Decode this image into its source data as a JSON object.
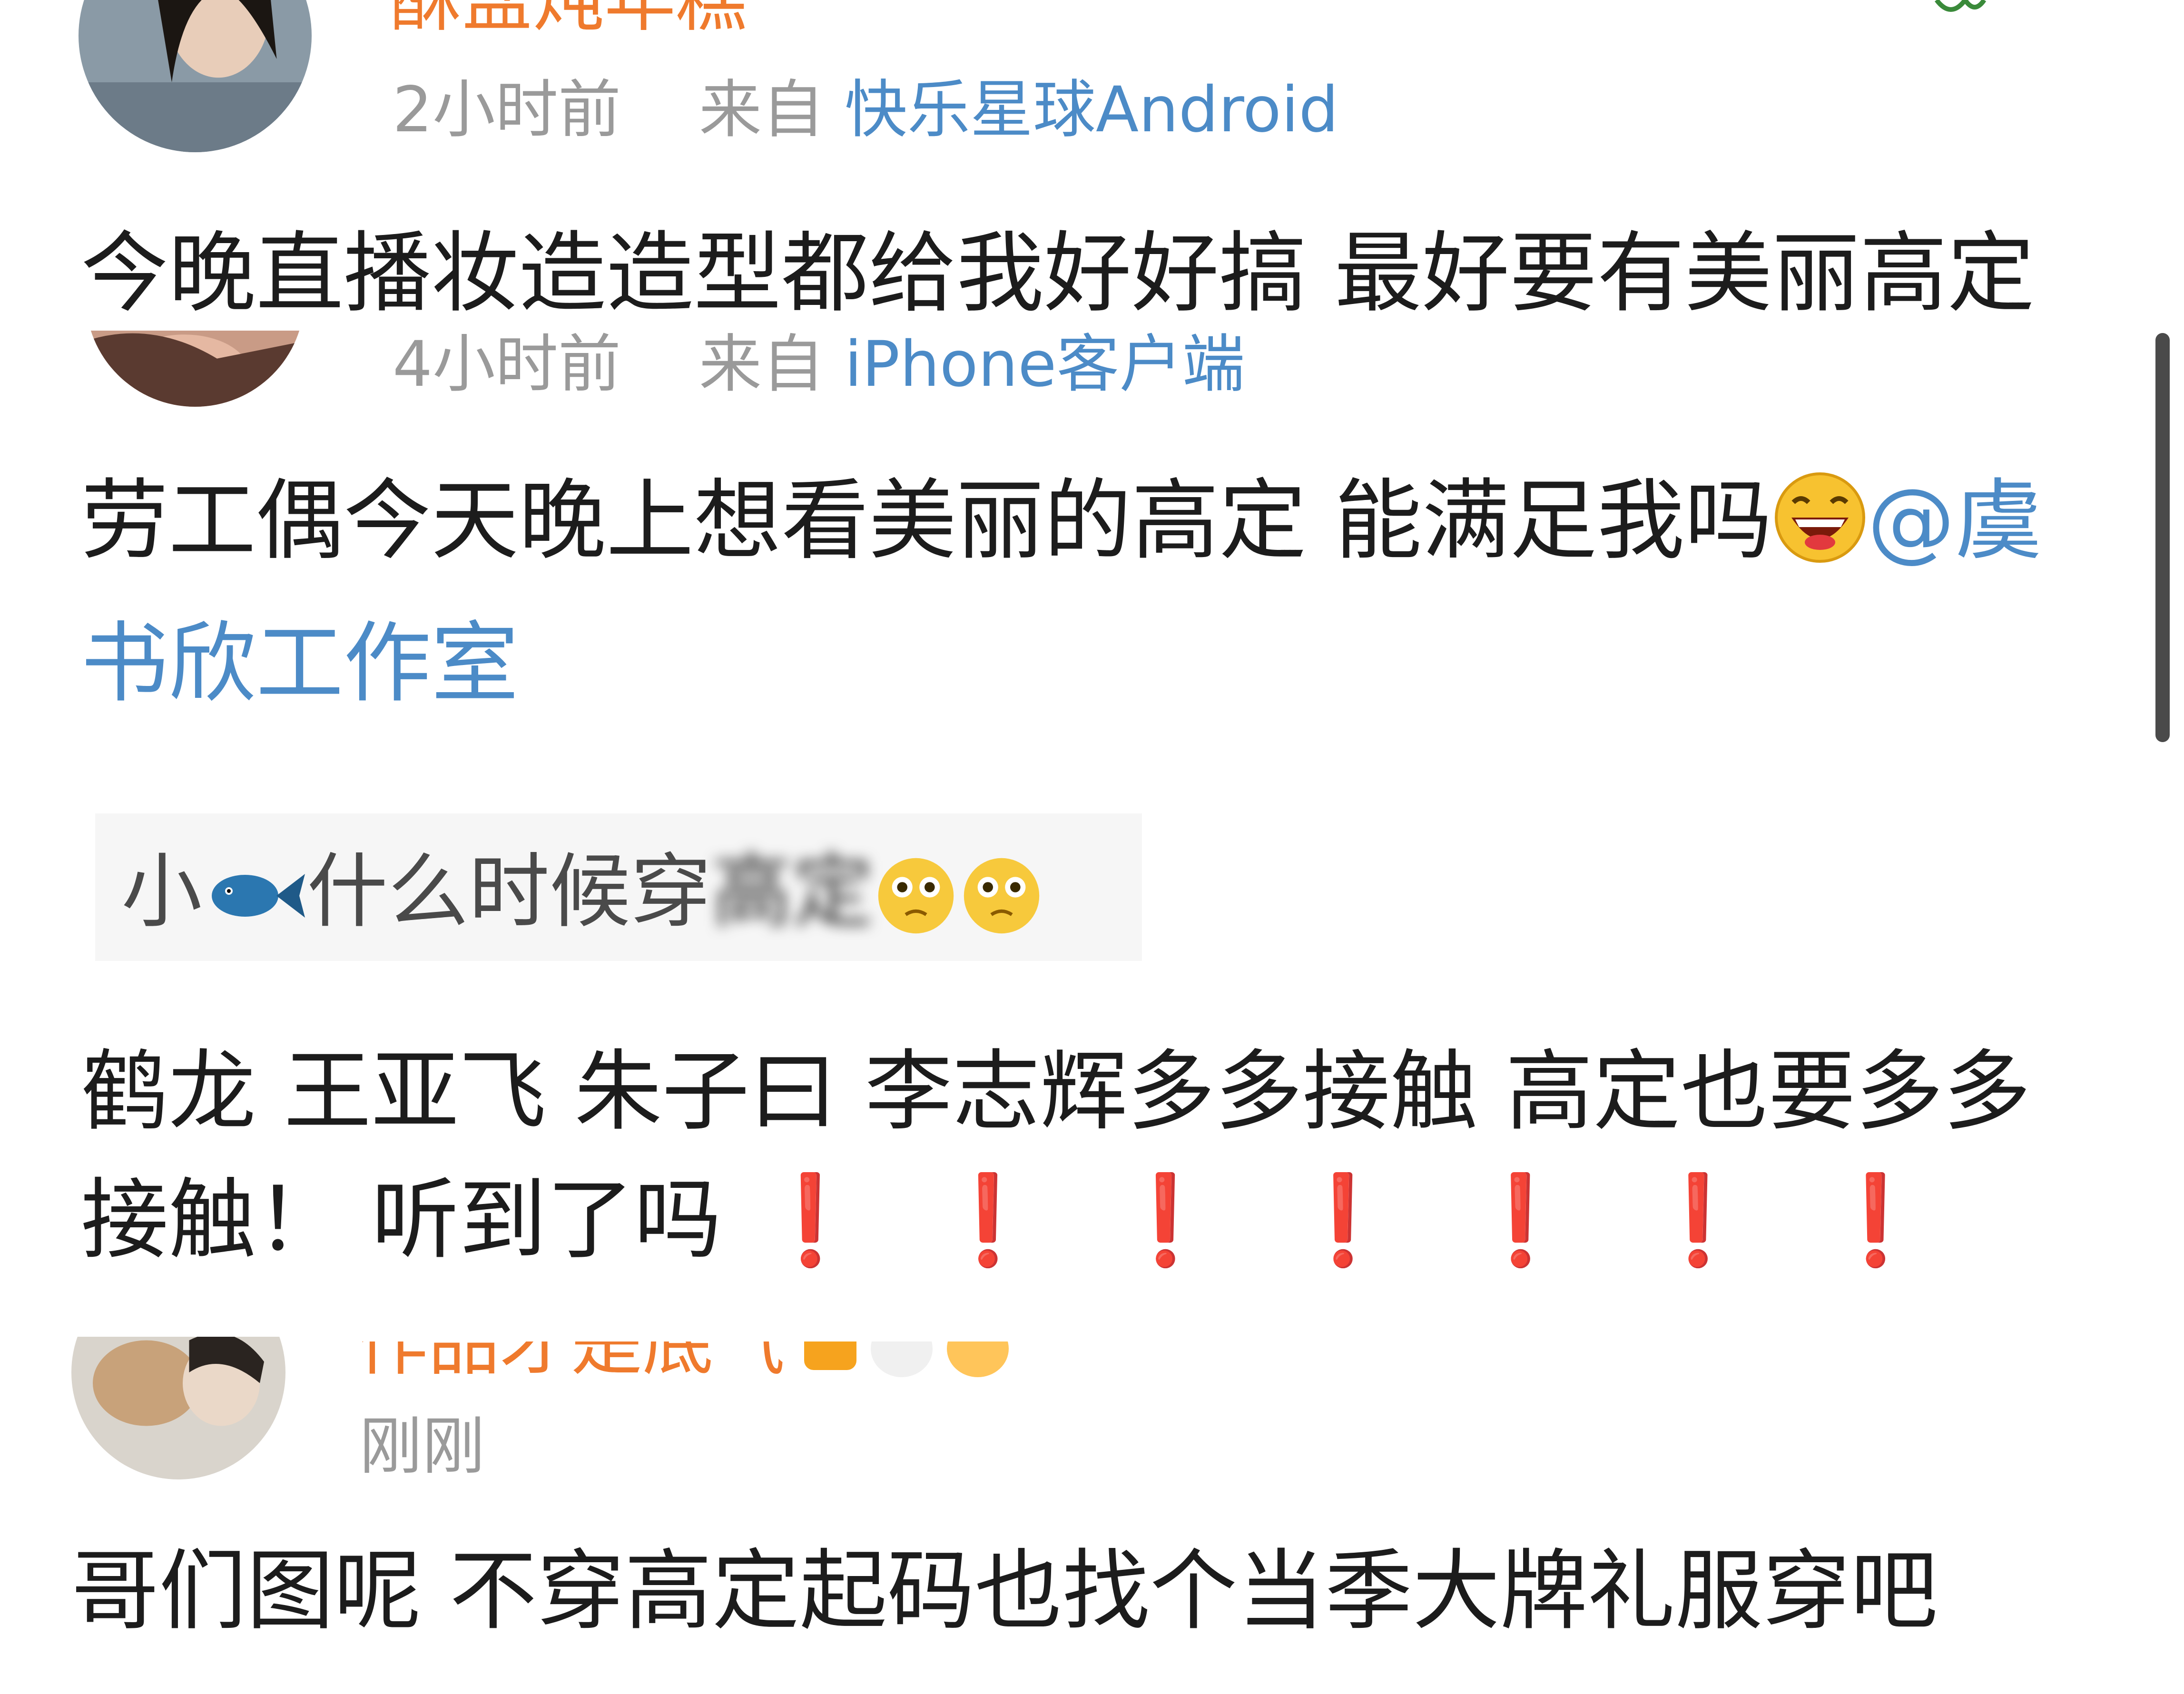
{
  "comments": [
    {
      "username": "酥盐炖年糕",
      "time": "2小时前",
      "source_prefix": "来自",
      "source": "快乐星球Android",
      "text": "今晚直播妆造造型都给我好好搞 最好要有美丽高定"
    },
    {
      "time": "4小时前",
      "source_prefix": "来自",
      "source": "iPhone客户端",
      "text_line1": "劳工偶今天晚上想看美丽的高定 能满足我吗",
      "mention_part1": "@虞",
      "mention_part2": "书欣工作室"
    },
    {
      "image_text_prefix": "小",
      "image_text_main": "什么时候穿",
      "image_text_blurred": "高定"
    },
    {
      "text_line1": "鹤龙 王亚飞 朱子曰 李志辉多多接触  高定也要多多",
      "text_line2": "接触！ 听到了吗",
      "exclaim": "❗"
    },
    {
      "username": "作品才是底气",
      "time": "刚刚",
      "text": "哥们图呢 不穿高定起码也找个当季大牌礼服穿吧"
    }
  ],
  "icons": [
    "laughing-emoji-icon",
    "fish-icon",
    "pleading-emoji-icon",
    "red-exclamation-icon",
    "panda-icon",
    "crown-badge-icon"
  ],
  "colors": {
    "link": "#4c8bc7",
    "username": "#ef7a2d",
    "meta": "#9a9a9a",
    "exclaim": "#e5252a"
  }
}
